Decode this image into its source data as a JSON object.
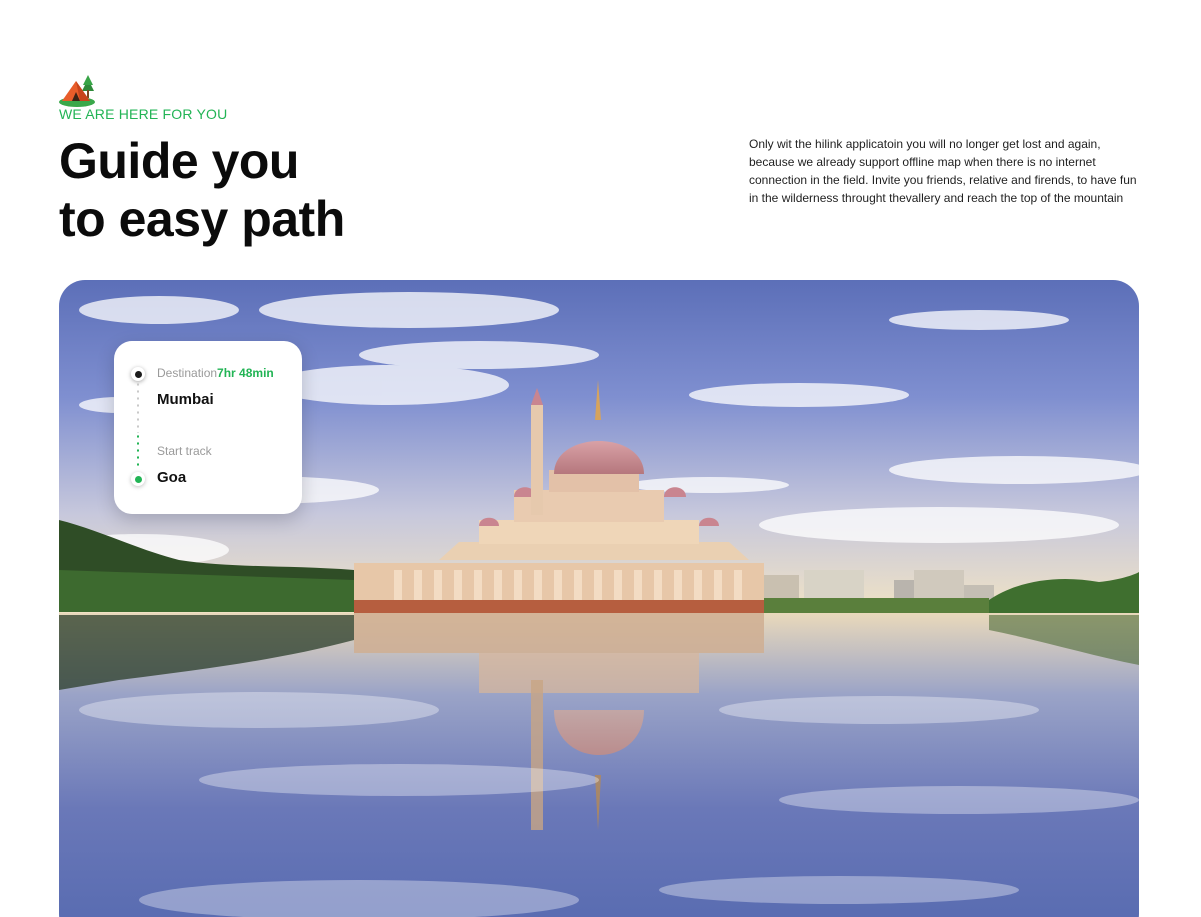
{
  "header": {
    "icon": "camping-tent-icon",
    "eyebrow": "WE ARE HERE FOR YOU",
    "headline_line1": "Guide you",
    "headline_line2": "to easy path",
    "description": "Only wit the hilink applicatoin you will no longer get lost and again, because we already support offline map when there is no internet connection in the field. Invite you friends, relative and firends, to have fun in the wilderness throught thevallery and reach the top of the mountain"
  },
  "hero": {
    "image": "mosque-on-lake-photo"
  },
  "route_card": {
    "destination_label": "Destination",
    "duration": "7hr 48min",
    "destination": "Mumbai",
    "start_label": "Start track",
    "start": "Goa"
  },
  "colors": {
    "accent_green": "#22b455",
    "text_dark": "#0b0b0b"
  }
}
